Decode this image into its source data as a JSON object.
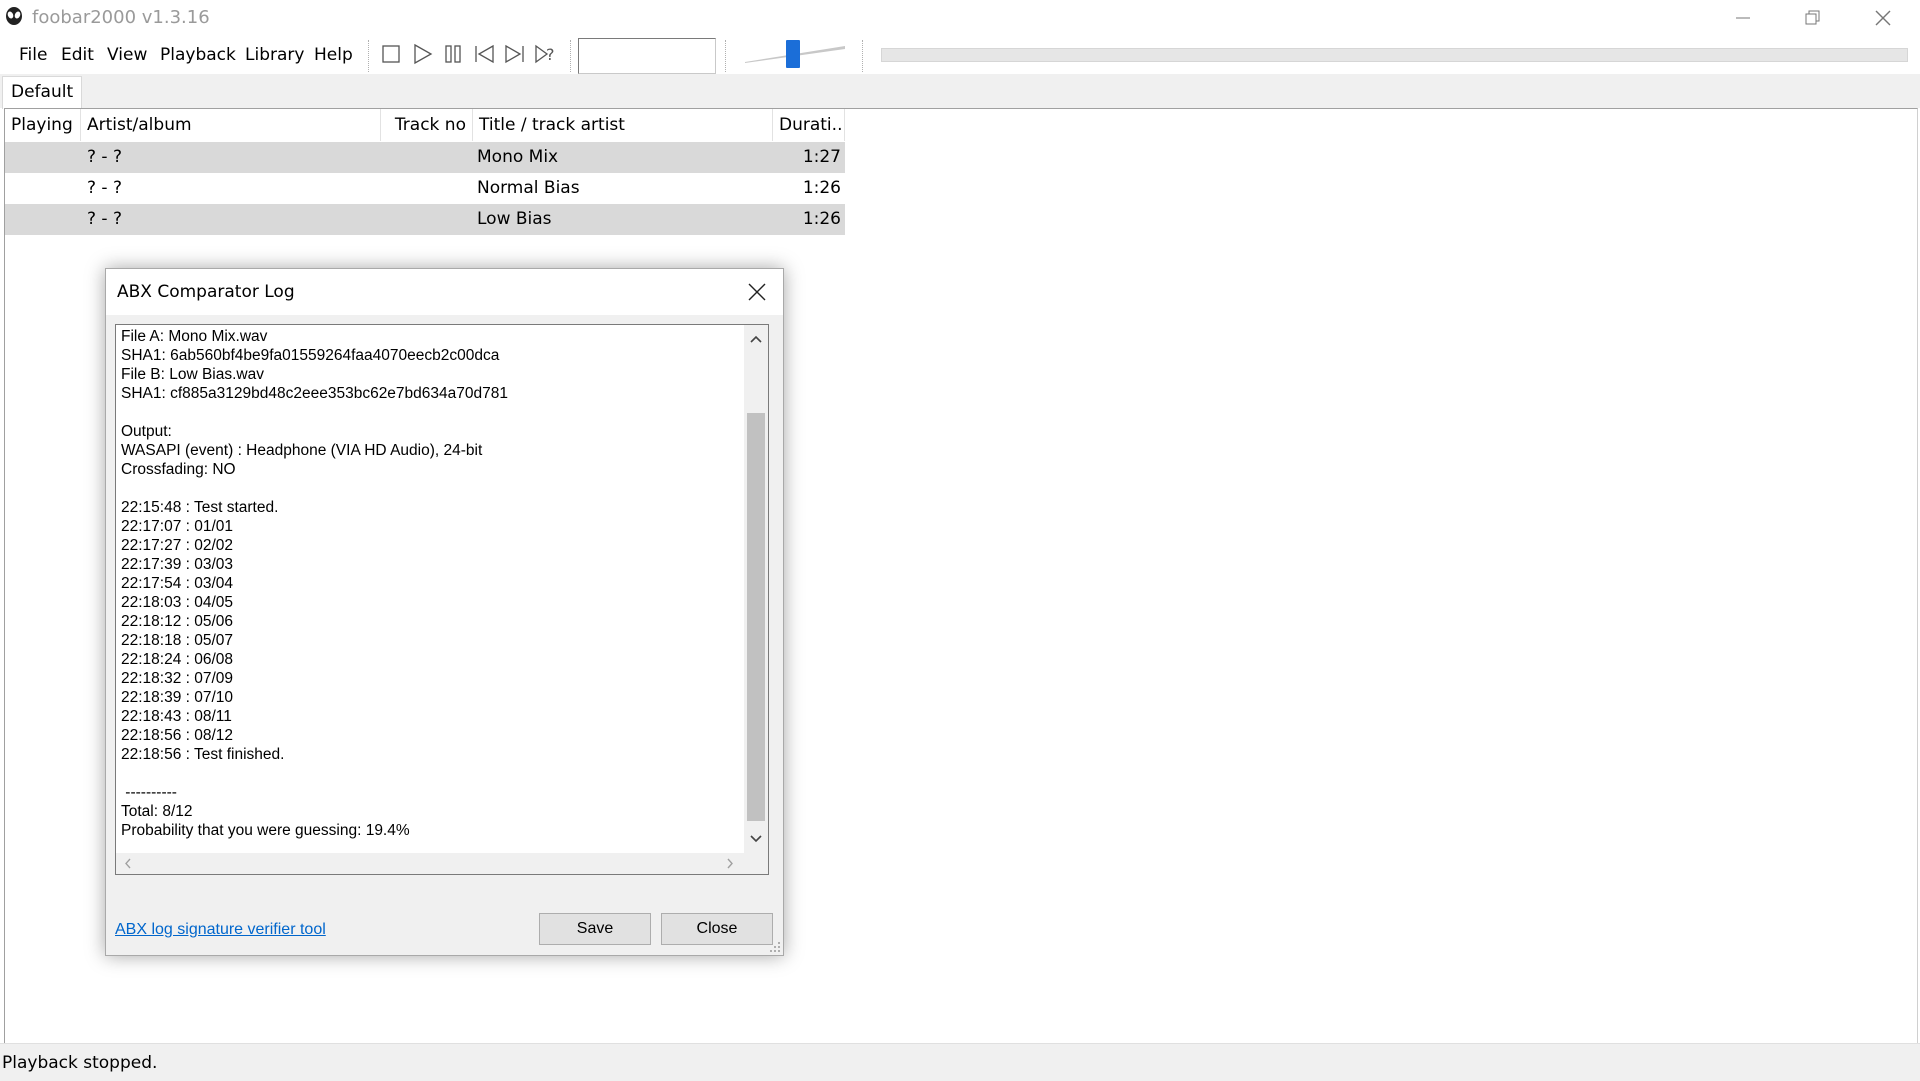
{
  "window": {
    "title": "foobar2000 v1.3.16"
  },
  "menu": [
    "File",
    "Edit",
    "View",
    "Playback",
    "Library",
    "Help"
  ],
  "toolbar": {
    "buttons": [
      "stop-icon",
      "play-icon",
      "pause-icon",
      "previous-icon",
      "next-icon",
      "random-icon"
    ],
    "volume_level": 0.48,
    "seek_position": 0
  },
  "tabs": [
    "Default"
  ],
  "playlist": {
    "columns": [
      "Playing",
      "Artist/album",
      "Track no",
      "Title / track artist",
      "Durati..."
    ],
    "rows": [
      {
        "playing": "",
        "artist_album": "? - ?",
        "track_no": "",
        "title": "Mono Mix",
        "duration": "1:27",
        "selected": true
      },
      {
        "playing": "",
        "artist_album": "? - ?",
        "track_no": "",
        "title": "Normal Bias",
        "duration": "1:26",
        "selected": false
      },
      {
        "playing": "",
        "artist_album": "? - ?",
        "track_no": "",
        "title": "Low Bias",
        "duration": "1:26",
        "selected": true
      }
    ]
  },
  "dialog": {
    "title": "ABX Comparator Log",
    "log_lines": [
      "File A: Mono Mix.wav",
      "SHA1: 6ab560bf4be9fa01559264faa4070eecb2c00dca",
      "File B: Low Bias.wav",
      "SHA1: cf885a3129bd48c2eee353bc62e7bd634a70d781",
      "",
      "Output:",
      "WASAPI (event) : Headphone (VIA HD Audio), 24-bit",
      "Crossfading: NO",
      "",
      "22:15:48 : Test started.",
      "22:17:07 : 01/01",
      "22:17:27 : 02/02",
      "22:17:39 : 03/03",
      "22:17:54 : 03/04",
      "22:18:03 : 04/05",
      "22:18:12 : 05/06",
      "22:18:18 : 05/07",
      "22:18:24 : 06/08",
      "22:18:32 : 07/09",
      "22:18:39 : 07/10",
      "22:18:43 : 08/11",
      "22:18:56 : 08/12",
      "22:18:56 : Test finished.",
      "",
      " ----------",
      "Total: 8/12",
      "Probability that you were guessing: 19.4%"
    ],
    "link": "ABX log signature verifier tool",
    "save_label": "Save",
    "close_label": "Close"
  },
  "status": "Playback stopped."
}
